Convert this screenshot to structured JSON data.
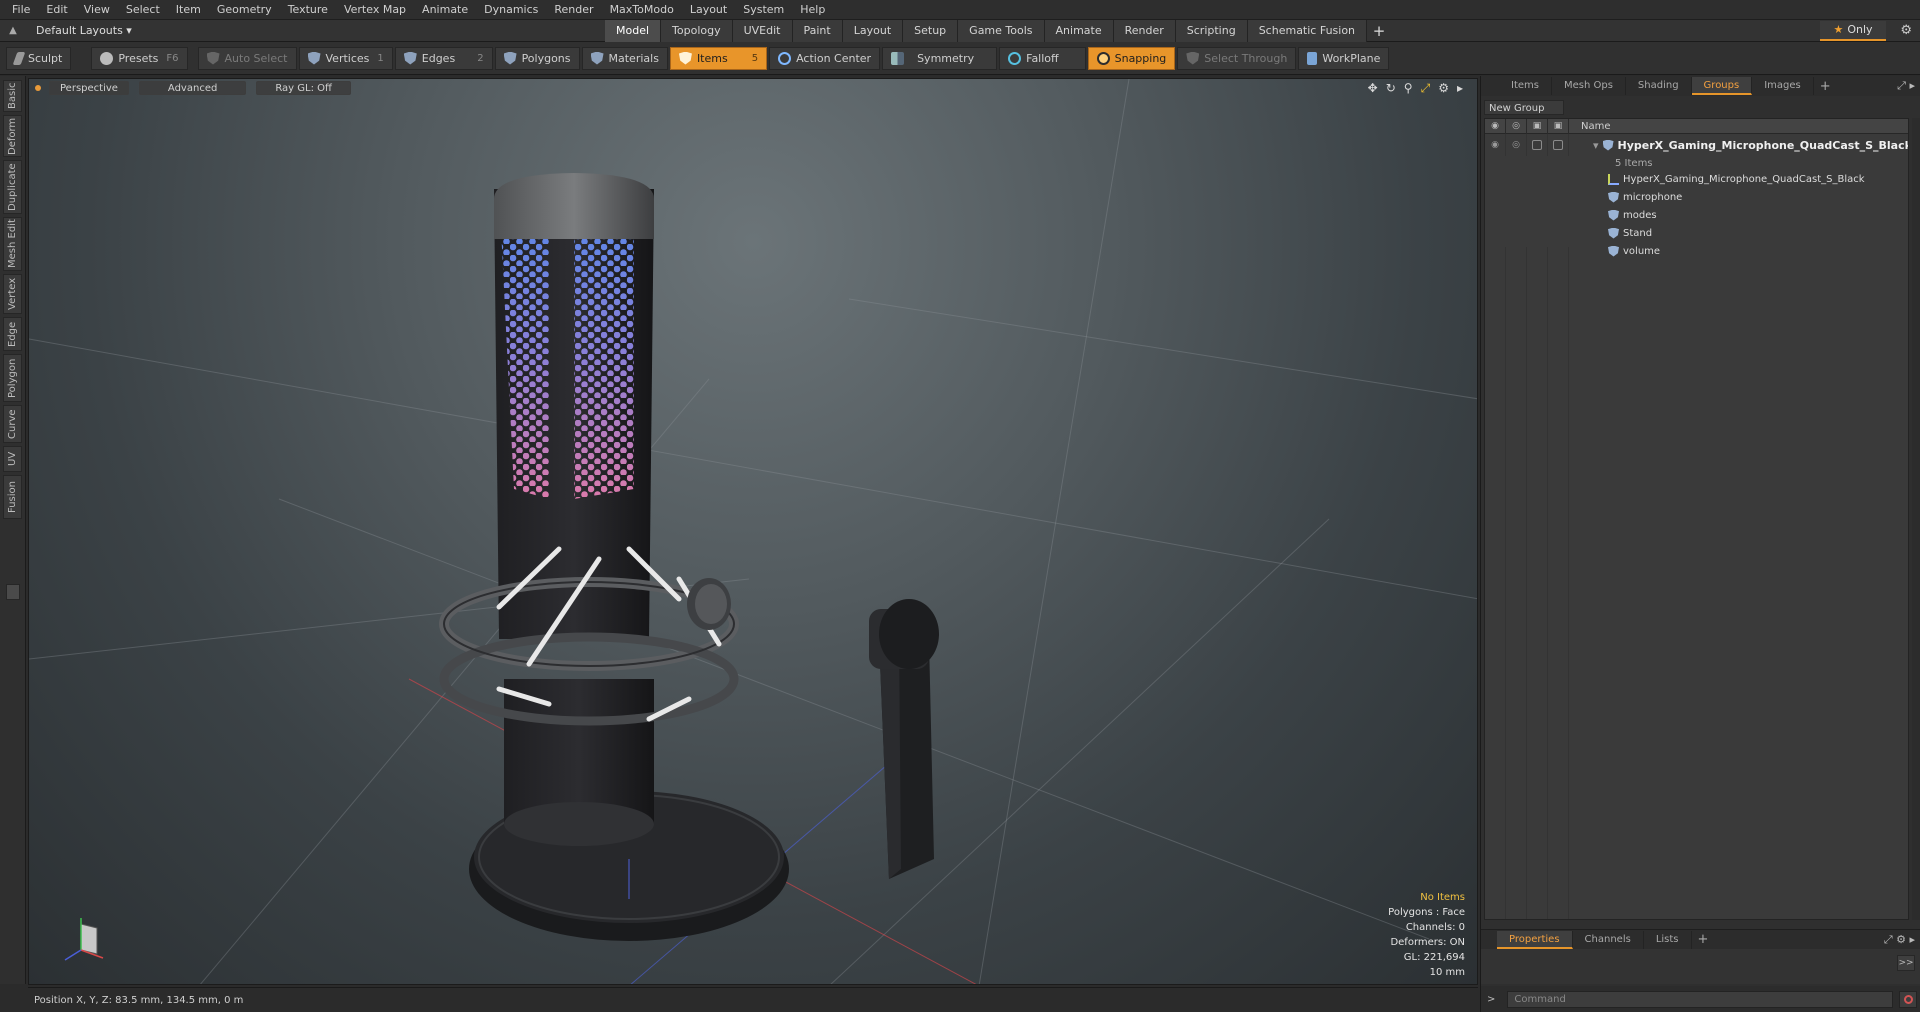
{
  "menu": [
    "File",
    "Edit",
    "View",
    "Select",
    "Item",
    "Geometry",
    "Texture",
    "Vertex Map",
    "Animate",
    "Dynamics",
    "Render",
    "MaxToModo",
    "Layout",
    "System",
    "Help"
  ],
  "layout": {
    "selector": "Default Layouts ▾",
    "tabs": [
      "Model",
      "Topology",
      "UVEdit",
      "Paint",
      "Layout",
      "Setup",
      "Game Tools",
      "Animate",
      "Render",
      "Scripting",
      "Schematic Fusion"
    ],
    "active_tab": "Model",
    "only_label": "Only"
  },
  "toolbar": {
    "sculpt": "Sculpt",
    "presets": "Presets",
    "presets_key": "F6",
    "auto_select": "Auto Select",
    "vertices": "Vertices",
    "vertices_count": "1",
    "edges": "Edges",
    "edges_count": "2",
    "polygons": "Polygons",
    "materials": "Materials",
    "items": "Items",
    "items_count": "5",
    "action_center": "Action Center",
    "symmetry": "Symmetry",
    "falloff": "Falloff",
    "snapping": "Snapping",
    "select_through": "Select Through",
    "workplane": "WorkPlane"
  },
  "left_tabs": [
    "Basic",
    "Deform",
    "Duplicate",
    "Mesh Edit",
    "Vertex",
    "Edge",
    "Polygon",
    "Curve",
    "UV",
    "Fusion"
  ],
  "viewport": {
    "view": "Perspective",
    "mode": "Advanced",
    "raygl": "Ray GL: Off",
    "stats": {
      "selection": "No Items",
      "polygons": "Polygons : Face",
      "channels": "Channels: 0",
      "deformers": "Deformers: ON",
      "gl": "GL: 221,694",
      "scale": "10 mm"
    }
  },
  "status": {
    "position": "Position X, Y, Z:  83.5 mm, 134.5 mm, 0 m"
  },
  "right_panel": {
    "tabs": [
      "Items",
      "Mesh Ops",
      "Shading",
      "Groups",
      "Images"
    ],
    "active_tab": "Groups",
    "new_group": "New Group",
    "name_header": "Name",
    "root": "HyperX_Gaming_Microphone_QuadCast_S_Black ...",
    "root_count": "5 Items",
    "children": [
      "HyperX_Gaming_Microphone_QuadCast_S_Black",
      "microphone",
      "modes",
      "Stand",
      "volume"
    ],
    "bottom_tabs": [
      "Properties",
      "Channels",
      "Lists"
    ],
    "bottom_active": "Properties",
    "command_placeholder": "Command"
  }
}
